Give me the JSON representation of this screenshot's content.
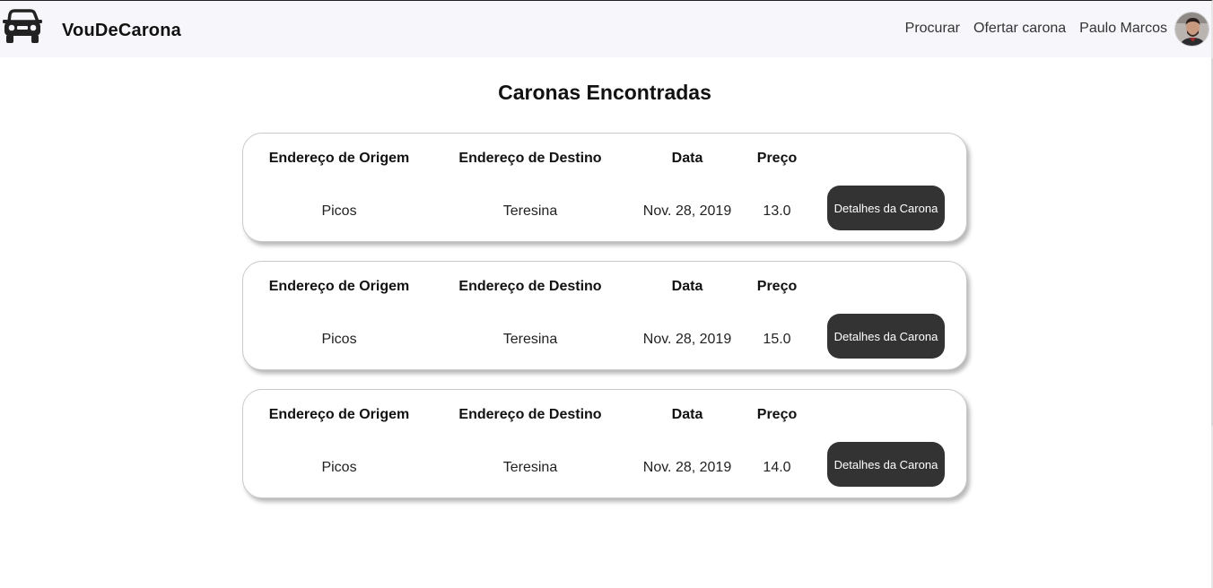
{
  "navbar": {
    "brand": "VouDeCarona",
    "links": [
      "Procurar",
      "Ofertar carona"
    ],
    "user_name": "Paulo Marcos",
    "logo_icon": "car-icon",
    "avatar_icon": "user-avatar"
  },
  "page": {
    "title": "Caronas Encontradas"
  },
  "headers": {
    "origin": "Endereço de Origem",
    "destination": "Endereço de Destino",
    "date": "Data",
    "price": "Preço"
  },
  "rides": [
    {
      "origin": "Picos",
      "destination": "Teresina",
      "date": "Nov. 28, 2019",
      "price": "13.0",
      "button": "Detalhes da Carona"
    },
    {
      "origin": "Picos",
      "destination": "Teresina",
      "date": "Nov. 28, 2019",
      "price": "15.0",
      "button": "Detalhes da Carona"
    },
    {
      "origin": "Picos",
      "destination": "Teresina",
      "date": "Nov. 28, 2019",
      "price": "14.0",
      "button": "Detalhes da Carona"
    }
  ],
  "colors": {
    "navbar_bg": "#f7f7fb",
    "button_bg": "#333333",
    "button_text": "#ffffff"
  }
}
